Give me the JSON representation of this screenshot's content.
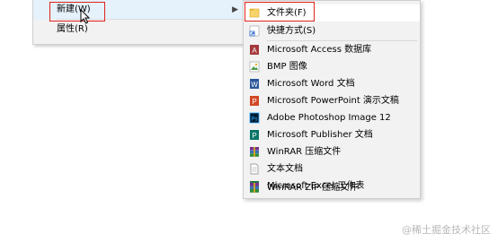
{
  "parent_menu": {
    "new_label": "新建(W)",
    "properties_label": "属性(R)"
  },
  "submenu": {
    "items": [
      {
        "label": "文件夹(F)",
        "icon": "folder-icon"
      },
      {
        "label": "快捷方式(S)",
        "icon": "shortcut-icon"
      },
      {
        "label": "Microsoft Access 数据库",
        "icon": "access-icon"
      },
      {
        "label": "BMP 图像",
        "icon": "bmp-icon"
      },
      {
        "label": "Microsoft Word 文档",
        "icon": "word-icon"
      },
      {
        "label": "Microsoft PowerPoint 演示文稿",
        "icon": "powerpoint-icon"
      },
      {
        "label": "Adobe Photoshop Image 12",
        "icon": "photoshop-icon"
      },
      {
        "label": "Microsoft Publisher 文档",
        "icon": "publisher-icon"
      },
      {
        "label": "WinRAR 压缩文件",
        "icon": "winrar-icon"
      },
      {
        "label": "文本文档",
        "icon": "text-document-icon"
      },
      {
        "label": "Microsoft Excel 工作表",
        "icon": "excel-icon"
      },
      {
        "label": "WinRAR ZIP 压缩文件",
        "icon": "winrar-zip-icon"
      }
    ]
  },
  "watermark": "@稀土掘金技术社区",
  "colors": {
    "highlight_box": "#e0221e",
    "menu_bg": "#f2f2f2",
    "hover_bg": "#e5f1fb"
  }
}
